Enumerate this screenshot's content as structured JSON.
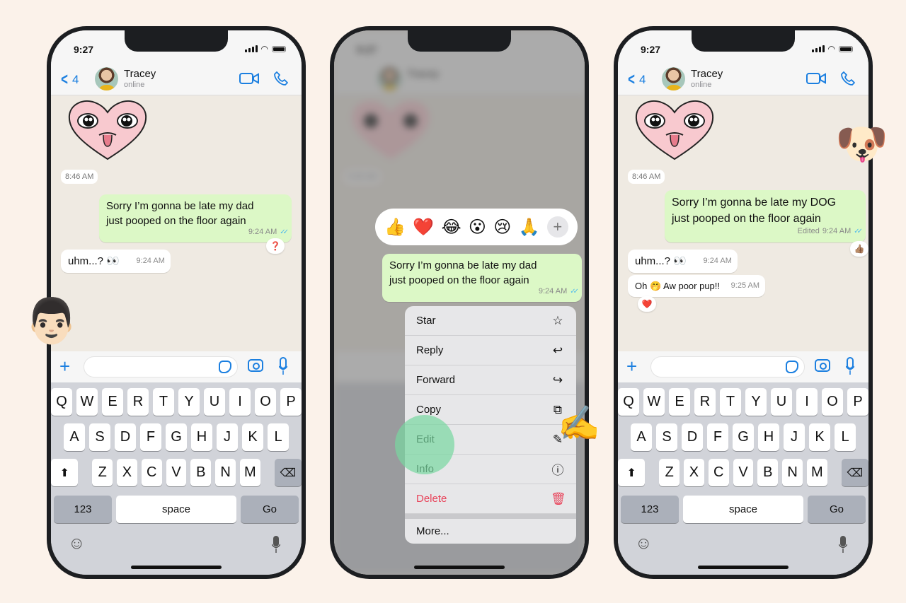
{
  "status_bar": {
    "time": "9:27"
  },
  "chat_header": {
    "back_count": "4",
    "contact_name": "Tracey",
    "contact_status": "online"
  },
  "colors": {
    "accent": "#1b7fe0",
    "bubble_out": "#dcf8c6",
    "bubble_in": "#ffffff",
    "read_ticks": "#53bdeb",
    "delete": "#e8435a",
    "background": "#fbf2ea"
  },
  "phone_left": {
    "date_label": "8:46 AM",
    "messages": [
      {
        "direction": "out",
        "text_line1": "Sorry I’m gonna be late my dad",
        "text_line2": "just pooped on the floor again",
        "time": "9:24 AM",
        "reaction": "❓"
      },
      {
        "direction": "in",
        "text": "uhm...? 👀",
        "time": "9:24 AM"
      }
    ],
    "floating_emoji": "👨🏻"
  },
  "phone_middle": {
    "reactions": [
      "👍",
      "❤️",
      "😂",
      "😮",
      "😢",
      "🙏"
    ],
    "add_reaction": "+",
    "selected_message": {
      "text_line1": "Sorry I’m gonna be late my dad",
      "text_line2": "just pooped on the floor again",
      "time": "9:24 AM"
    },
    "menu": [
      {
        "label": "Star",
        "icon": "☆"
      },
      {
        "label": "Reply",
        "icon": "↩"
      },
      {
        "label": "Forward",
        "icon": "↪"
      },
      {
        "label": "Copy",
        "icon": "⧉"
      },
      {
        "label": "Edit",
        "icon": "✎"
      },
      {
        "label": "Info",
        "icon": "ⓘ"
      },
      {
        "label": "Delete",
        "icon": "🗑"
      },
      {
        "label": "More..."
      }
    ],
    "floating_emoji": "✍️"
  },
  "phone_right": {
    "date_label": "8:46 AM",
    "messages": [
      {
        "direction": "out",
        "text_line1": "Sorry I’m gonna be late my DOG",
        "text_line2": "just pooped on the floor again",
        "edited_label": "Edited",
        "time": "9:24 AM",
        "reaction": "👍🏽"
      },
      {
        "direction": "in",
        "text": "uhm...? 👀",
        "time": "9:24 AM"
      },
      {
        "direction": "in",
        "text": "Oh 🤭 Aw poor pup!!",
        "time": "9:25 AM",
        "reaction": "❤️"
      }
    ],
    "floating_emoji": "🐶"
  },
  "keyboard": {
    "row1": [
      "Q",
      "W",
      "E",
      "R",
      "T",
      "Y",
      "U",
      "I",
      "O",
      "P"
    ],
    "row2": [
      "A",
      "S",
      "D",
      "F",
      "G",
      "H",
      "J",
      "K",
      "L"
    ],
    "row3": [
      "Z",
      "X",
      "C",
      "V",
      "B",
      "N",
      "M"
    ],
    "numbers_key": "123",
    "space_key": "space",
    "go_key": "Go",
    "shift_icon": "⬆",
    "backspace_icon": "⌫",
    "emoji_icon": "☺"
  }
}
